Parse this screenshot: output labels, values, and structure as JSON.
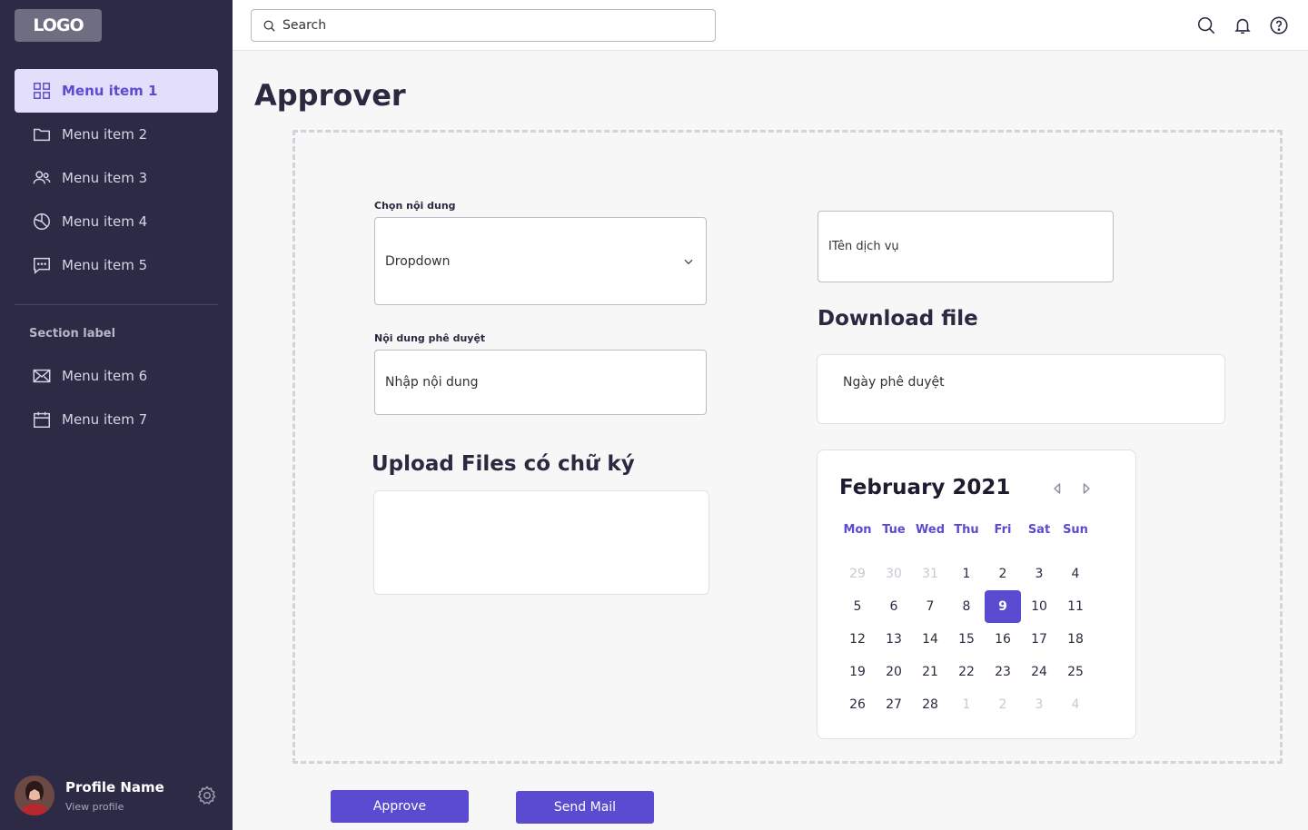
{
  "colors": {
    "sidebar": "#2c2a45",
    "accent": "#5a4bd1",
    "active_bg": "#e3dffa"
  },
  "sidebar": {
    "logo": "LOGO",
    "items": [
      {
        "label": "Menu item 1",
        "icon": "grid-icon"
      },
      {
        "label": "Menu item 2",
        "icon": "folder-icon"
      },
      {
        "label": "Menu item 3",
        "icon": "users-icon"
      },
      {
        "label": "Menu item 4",
        "icon": "pie-chart-icon"
      },
      {
        "label": "Menu item 5",
        "icon": "message-icon"
      }
    ],
    "section_label": "Section label",
    "items2": [
      {
        "label": "Menu item 6",
        "icon": "mail-icon"
      },
      {
        "label": "Menu item 7",
        "icon": "calendar-icon"
      }
    ],
    "profile": {
      "name": "Profile Name",
      "sub": "View profile"
    }
  },
  "topbar": {
    "search_placeholder": "Search"
  },
  "main": {
    "title": "Approver",
    "select_label": "Chọn nội dung",
    "dropdown_value": "Dropdown",
    "service_name": "ITên dịch vụ",
    "approval_label": "Nội dung phê duyệt",
    "approval_placeholder": "Nhập nội dung",
    "download_title": "Download file",
    "approval_date": "Ngày phê duyệt",
    "upload_title": "Upload Files có chữ ký",
    "approve_button": "Approve",
    "send_mail_button": "Send Mail"
  },
  "calendar": {
    "title": "February 2021",
    "weekdays": [
      "Mon",
      "Tue",
      "Wed",
      "Thu",
      "Fri",
      "Sat",
      "Sun"
    ],
    "weeks": [
      [
        "29",
        "30",
        "31",
        "1",
        "2",
        "3",
        "4"
      ],
      [
        "5",
        "6",
        "7",
        "8",
        "9",
        "10",
        "11"
      ],
      [
        "12",
        "13",
        "14",
        "15",
        "16",
        "17",
        "18"
      ],
      [
        "19",
        "20",
        "21",
        "22",
        "23",
        "24",
        "25"
      ],
      [
        "26",
        "27",
        "28",
        "1",
        "2",
        "3",
        "4"
      ]
    ],
    "selected": "9"
  }
}
